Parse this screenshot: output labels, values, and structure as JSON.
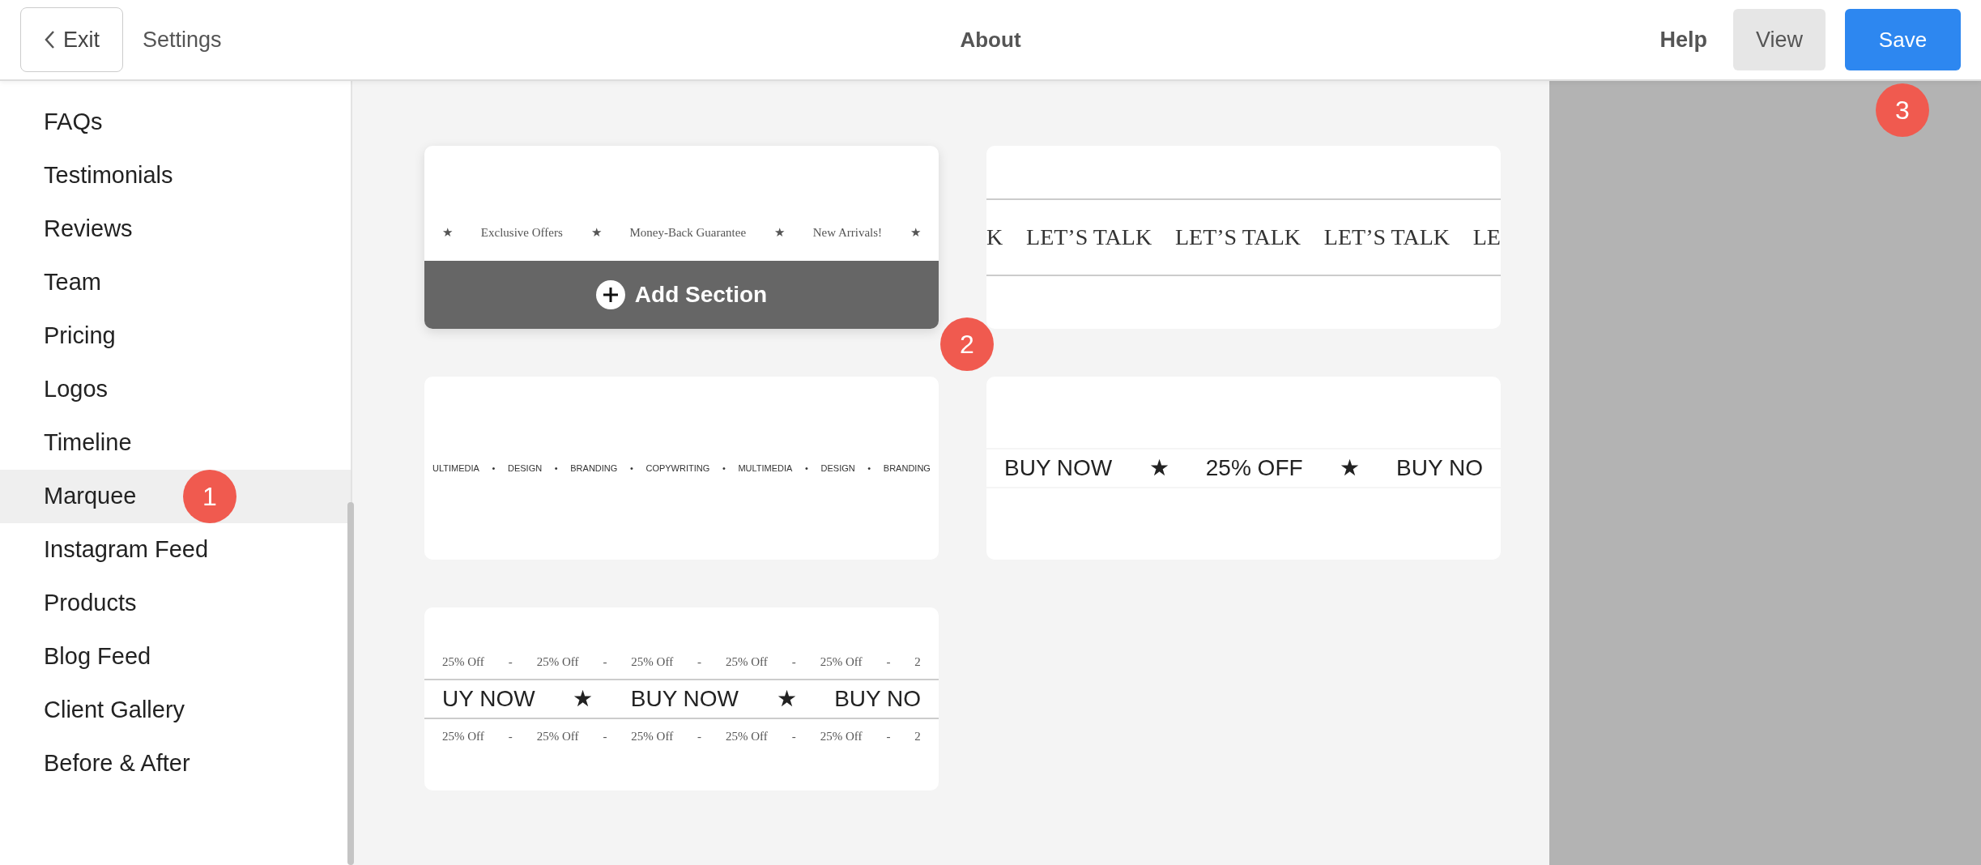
{
  "header": {
    "exit_button": "Exit",
    "settings_link": "Settings",
    "page_title": "About",
    "help_link": "Help",
    "view_button": "View",
    "save_button": "Save",
    "save_marker": "3"
  },
  "sidebar": {
    "items": [
      {
        "label": "FAQs",
        "selected": false
      },
      {
        "label": "Testimonials",
        "selected": false
      },
      {
        "label": "Reviews",
        "selected": false
      },
      {
        "label": "Team",
        "selected": false
      },
      {
        "label": "Pricing",
        "selected": false
      },
      {
        "label": "Logos",
        "selected": false
      },
      {
        "label": "Timeline",
        "selected": false
      },
      {
        "label": "Marquee",
        "selected": true,
        "marker": "1"
      },
      {
        "label": "Instagram Feed",
        "selected": false
      },
      {
        "label": "Products",
        "selected": false
      },
      {
        "label": "Blog Feed",
        "selected": false
      },
      {
        "label": "Client Gallery",
        "selected": false
      },
      {
        "label": "Before & After",
        "selected": false
      }
    ]
  },
  "sections": [
    {
      "add_section": "Add Section",
      "marker": "2",
      "rows": [
        {
          "kind": "serif-small",
          "items": [
            "★",
            "Exclusive Offers",
            "★",
            "Money-Back Guarantee",
            "★",
            "New Arrivals!",
            "★"
          ]
        }
      ]
    },
    {
      "rows": [
        {
          "kind": "serif-large-ruled",
          "items": [
            "K",
            "LET’S TALK",
            "LET’S TALK",
            "LET’S TALK",
            "LE"
          ]
        }
      ]
    },
    {
      "rows": [
        {
          "kind": "sans-tiny",
          "items": [
            "ULTIMEDIA",
            "•",
            "DESIGN",
            "•",
            "BRANDING",
            "•",
            "COPYWRITING",
            "•",
            "MULTIMEDIA",
            "•",
            "DESIGN",
            "•",
            "BRANDING"
          ]
        }
      ]
    },
    {
      "rows": [
        {
          "kind": "sans-large",
          "items": [
            "BUY NOW",
            "★",
            "25% OFF",
            "★",
            "BUY NO"
          ]
        }
      ]
    },
    {
      "rows": [
        {
          "kind": "serif-small",
          "items": [
            "25% Off",
            "-",
            "25% Off",
            "-",
            "25% Off",
            "-",
            "25% Off",
            "-",
            "25% Off",
            "-",
            "2"
          ]
        },
        {
          "kind": "sans-large-ruled",
          "items": [
            "UY NOW",
            "★",
            "BUY NOW",
            "★",
            "BUY NO"
          ]
        },
        {
          "kind": "serif-small",
          "items": [
            "25% Off",
            "-",
            "25% Off",
            "-",
            "25% Off",
            "-",
            "25% Off",
            "-",
            "25% Off",
            "-",
            "2"
          ]
        }
      ]
    }
  ]
}
